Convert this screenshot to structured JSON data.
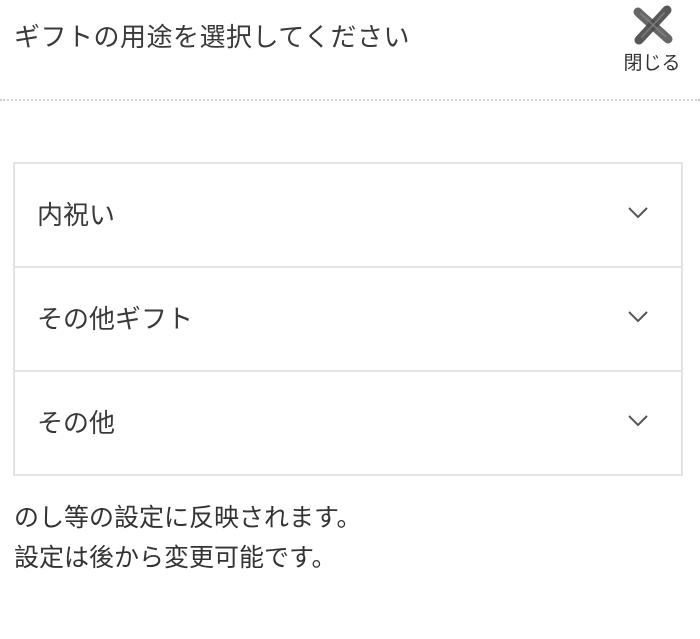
{
  "header": {
    "title": "ギフトの用途を選択してください",
    "close_label": "閉じる",
    "close_icon": "close-icon"
  },
  "accordion": {
    "items": [
      {
        "label": "内祝い",
        "icon": "chevron-down-icon"
      },
      {
        "label": "その他ギフト",
        "icon": "chevron-down-icon"
      },
      {
        "label": "その他",
        "icon": "chevron-down-icon"
      }
    ]
  },
  "note": {
    "line1": "のし等の設定に反映されます。",
    "line2": "設定は後から変更可能です。"
  },
  "colors": {
    "text": "#333333",
    "border": "#e3e3e3",
    "divider": "#cfcfcf",
    "close_icon": "#555555"
  }
}
